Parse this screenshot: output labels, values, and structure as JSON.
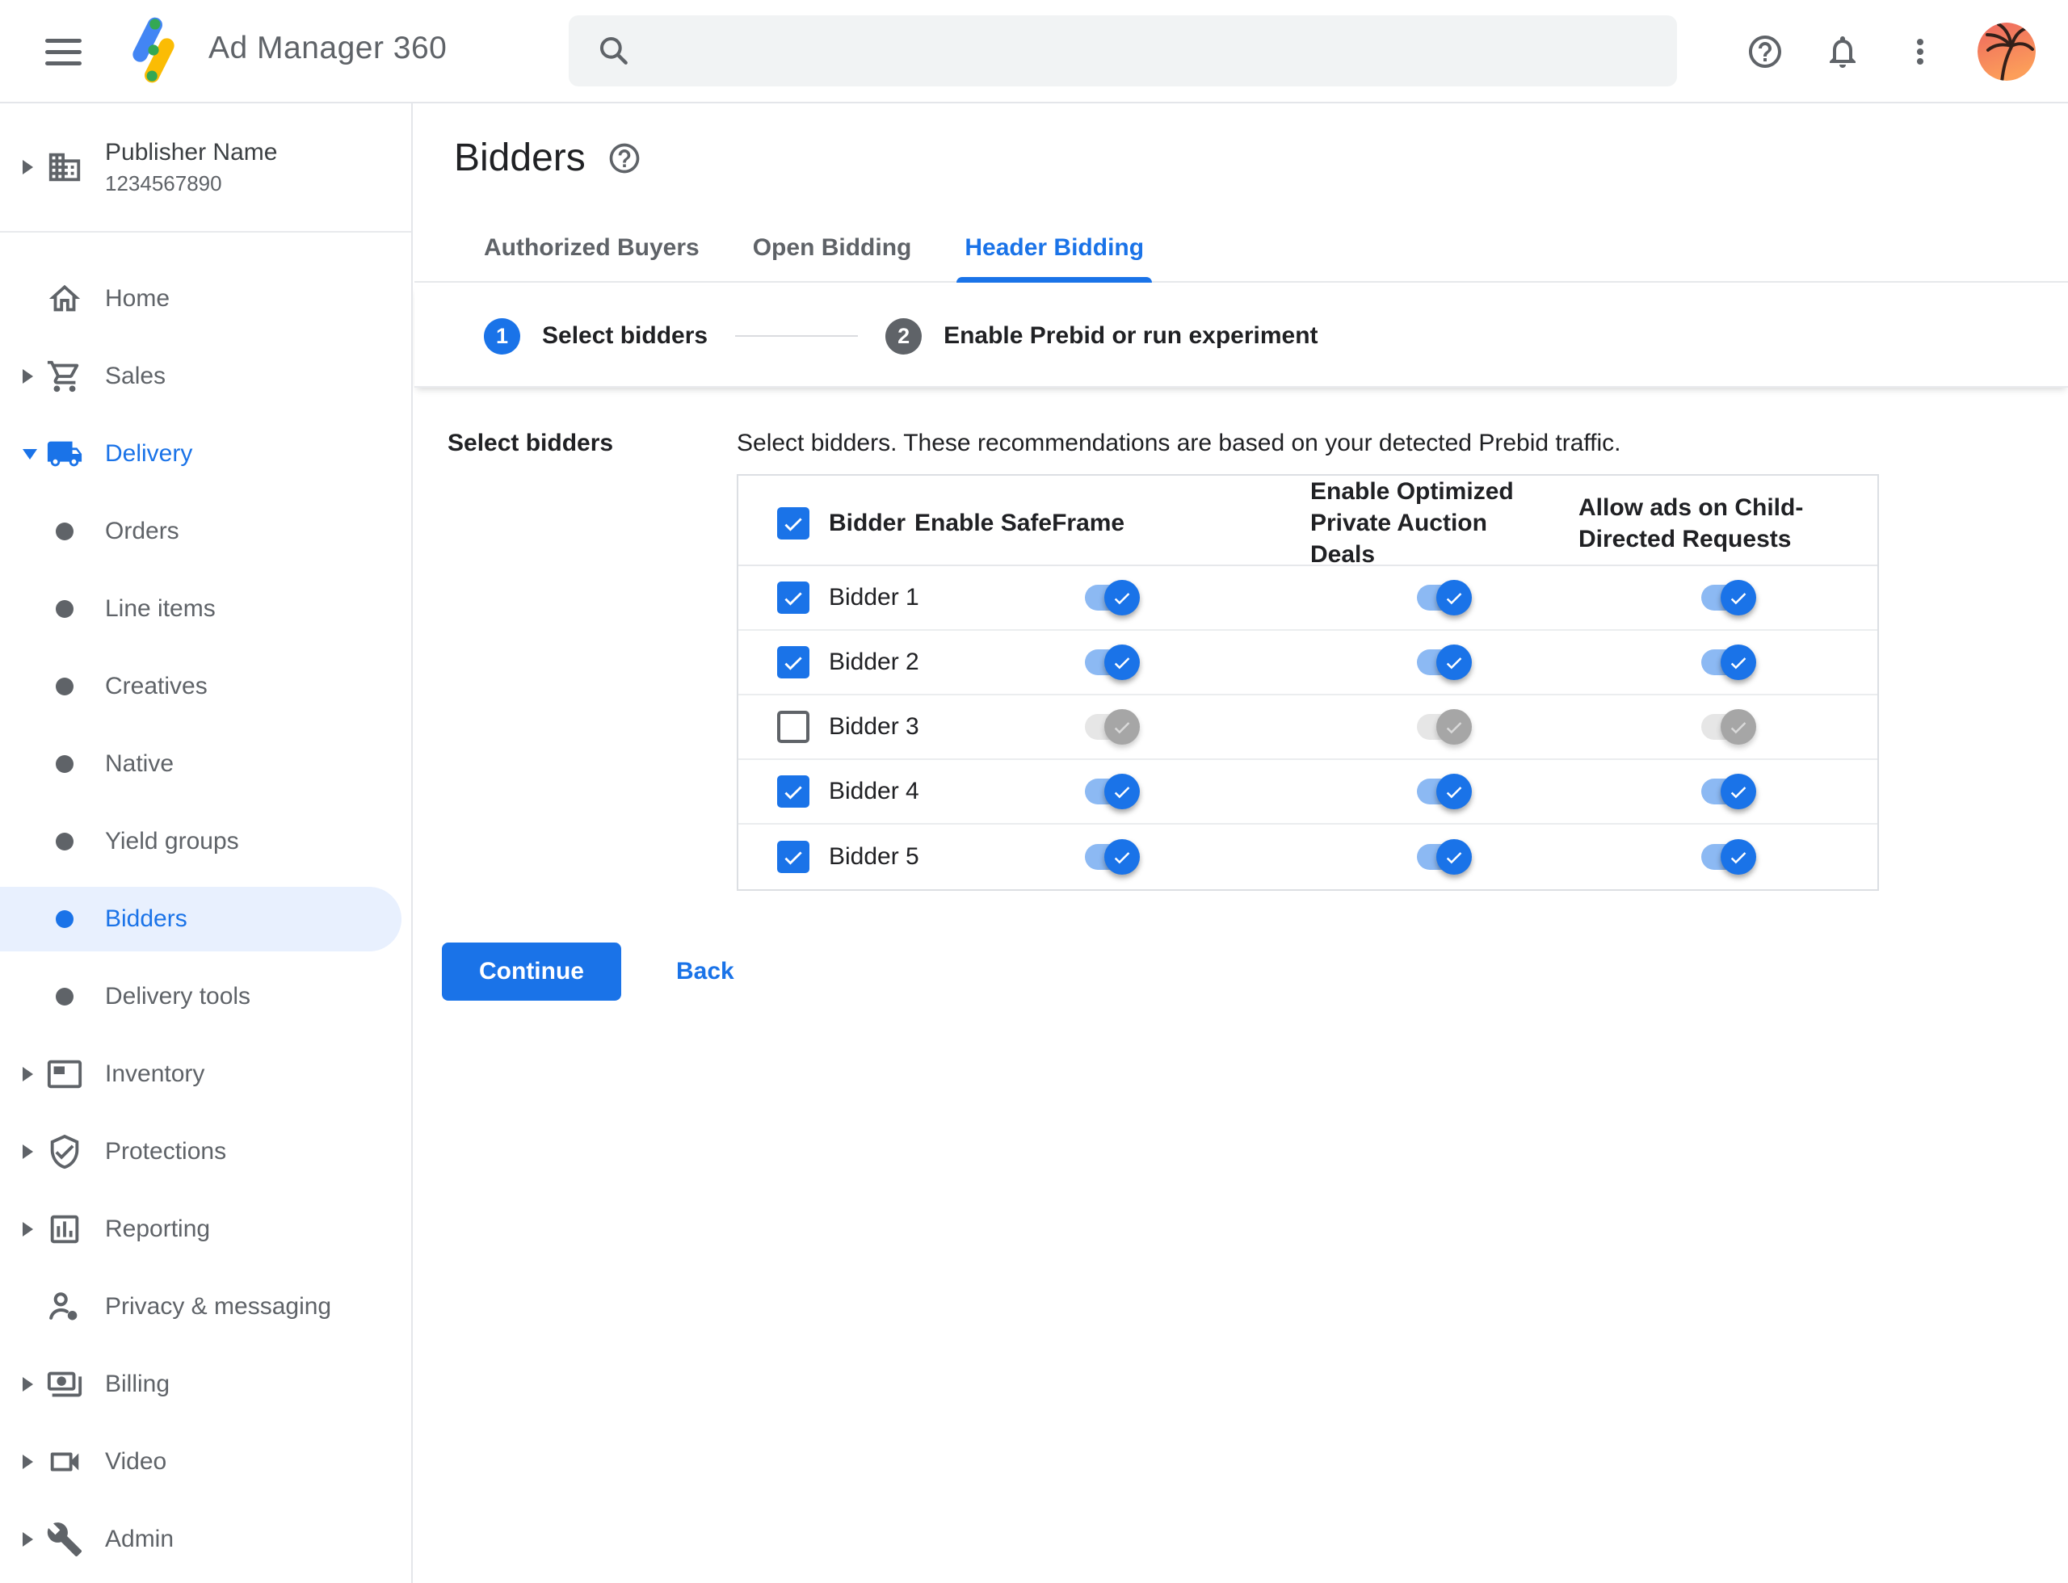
{
  "colors": {
    "accent": "#1a73e8",
    "accent_light": "#e8f0fe",
    "toggle_track_on": "#8cb9f3",
    "toggle_off_thumb": "#a6a6a6",
    "text_primary": "#202124",
    "text_secondary": "#5f6368",
    "border": "#dadce0"
  },
  "topbar": {
    "app_name": "Ad Manager 360",
    "search_placeholder": ""
  },
  "sidebar": {
    "publisher": {
      "name": "Publisher Name",
      "id": "1234567890"
    },
    "items": [
      {
        "label": "Home"
      },
      {
        "label": "Sales"
      },
      {
        "label": "Delivery"
      },
      {
        "label": "Orders"
      },
      {
        "label": "Line items"
      },
      {
        "label": "Creatives"
      },
      {
        "label": "Native"
      },
      {
        "label": "Yield groups"
      },
      {
        "label": "Bidders"
      },
      {
        "label": "Delivery tools"
      },
      {
        "label": "Inventory"
      },
      {
        "label": "Protections"
      },
      {
        "label": "Reporting"
      },
      {
        "label": "Privacy & messaging"
      },
      {
        "label": "Billing"
      },
      {
        "label": "Video"
      },
      {
        "label": "Admin"
      }
    ],
    "active_item": "Bidders"
  },
  "page": {
    "title": "Bidders",
    "tabs": [
      {
        "label": "Authorized Buyers"
      },
      {
        "label": "Open Bidding"
      },
      {
        "label": "Header Bidding"
      }
    ],
    "active_tab": "Header Bidding",
    "stepper": [
      {
        "number": "1",
        "label": "Select bidders"
      },
      {
        "number": "2",
        "label": "Enable Prebid or run experiment"
      }
    ],
    "section_label": "Select bidders",
    "description": "Select bidders. These recommendations are based on your detected Prebid traffic.",
    "table": {
      "header_checkbox_checked": true,
      "headers": [
        "Bidder",
        "Enable SafeFrame",
        "Enable Optimized Private Auction Deals",
        "Allow ads on Child-Directed Requests"
      ],
      "rows": [
        {
          "name": "Bidder 1",
          "selected": true,
          "safeframe": true,
          "optimized": true,
          "child_directed": true
        },
        {
          "name": "Bidder 2",
          "selected": true,
          "safeframe": true,
          "optimized": true,
          "child_directed": true
        },
        {
          "name": "Bidder 3",
          "selected": false,
          "safeframe": false,
          "optimized": false,
          "child_directed": false
        },
        {
          "name": "Bidder 4",
          "selected": true,
          "safeframe": true,
          "optimized": true,
          "child_directed": true
        },
        {
          "name": "Bidder 5",
          "selected": true,
          "safeframe": true,
          "optimized": true,
          "child_directed": true
        }
      ]
    },
    "actions": {
      "continue": "Continue",
      "back": "Back"
    }
  }
}
